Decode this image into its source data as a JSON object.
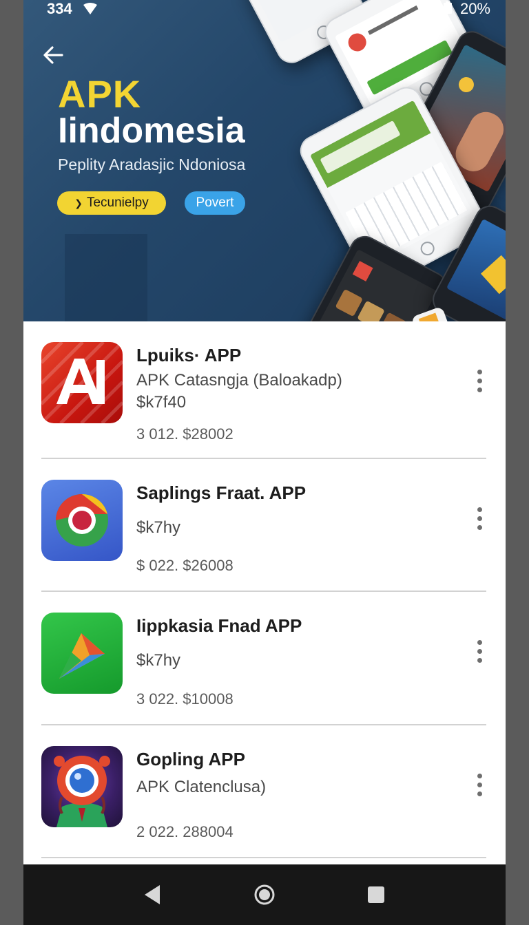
{
  "status_bar": {
    "time": "334",
    "battery": "20%"
  },
  "hero": {
    "title_line1": "APK",
    "title_line2": "Iindomesia",
    "subtitle": "Peplity Aradasjic Ndoniosa",
    "chip_primary": "Tecunielpy",
    "chip_secondary": "Povert",
    "background_color": "#24476a",
    "accent_color": "#f3d533"
  },
  "apps": [
    {
      "title": "Lpuiks· APP",
      "subtitle": "APK Catasngja (Baloakadp)",
      "price": "$k7f40",
      "meta": "3 012. $28002",
      "icon": "letter-a-logo-icon"
    },
    {
      "title": "Saplings Fraat. APP",
      "subtitle": "",
      "price": "$k7hy",
      "meta": "$ 022. $26008",
      "icon": "chrome-style-icon"
    },
    {
      "title": "Iippkasia Fnad APP",
      "subtitle": "",
      "price": "$k7hy",
      "meta": "3 022. $10008",
      "icon": "green-play-icon"
    },
    {
      "title": "Gopling APP",
      "subtitle": "APK Clatenclusa)",
      "price": "",
      "meta": "2 022. 288004",
      "icon": "red-camera-character-icon"
    }
  ],
  "nav": {
    "back": "back-triangle-icon",
    "home": "home-circle-icon",
    "recents": "recents-square-icon"
  }
}
